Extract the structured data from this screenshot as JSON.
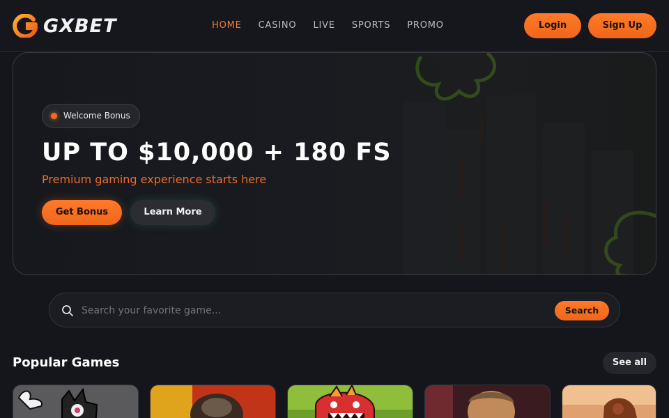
{
  "brand": {
    "name": "GXBET"
  },
  "nav": {
    "items": [
      {
        "label": "HOME",
        "active": true
      },
      {
        "label": "CASINO",
        "active": false
      },
      {
        "label": "LIVE",
        "active": false
      },
      {
        "label": "SPORTS",
        "active": false
      },
      {
        "label": "PROMO",
        "active": false
      }
    ]
  },
  "auth": {
    "login_label": "Login",
    "signup_label": "Sign Up"
  },
  "hero": {
    "badge": "Welcome Bonus",
    "title": "UP TO $10,000 + 180 FS",
    "subtitle": "Premium gaming experience starts here",
    "primary_cta": "Get Bonus",
    "secondary_cta": "Learn More"
  },
  "search": {
    "placeholder": "Search your favorite game...",
    "button_label": "Search",
    "icon": "search-icon"
  },
  "popular": {
    "title": "Popular Games",
    "see_all_label": "See all",
    "cards": [
      {
        "name": "game-card-1"
      },
      {
        "name": "game-card-2"
      },
      {
        "name": "game-card-3"
      },
      {
        "name": "game-card-4"
      },
      {
        "name": "game-card-5"
      }
    ]
  },
  "colors": {
    "accent": "#f26b22",
    "background": "#14161c",
    "active_nav": "#f47a31"
  }
}
